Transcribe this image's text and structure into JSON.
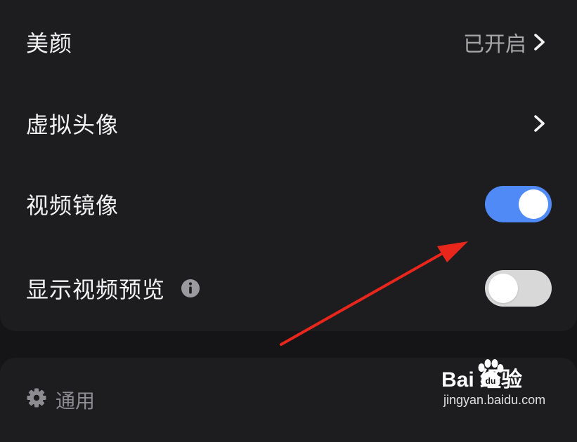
{
  "settings": {
    "rows": [
      {
        "label": "美颜",
        "value": "已开启",
        "control": "chevron"
      },
      {
        "label": "虚拟头像",
        "control": "chevron"
      },
      {
        "label": "视频镜像",
        "control": "toggle",
        "on": true
      },
      {
        "label": "显示视频预览",
        "control": "toggle",
        "on": false,
        "info_icon": "info-icon"
      }
    ]
  },
  "general_section": {
    "icon": "gear-icon",
    "label": "通用"
  },
  "annotation": {
    "type": "red-arrow",
    "color": "#e8261c"
  },
  "watermark": {
    "logo_text": "Bai  经验",
    "url": "jingyan.baidu.com"
  },
  "colors": {
    "toggle_on": "#4f8af7",
    "toggle_off": "#d8d8d9",
    "card_bg": "#1d1d1f",
    "page_bg": "#151517"
  }
}
